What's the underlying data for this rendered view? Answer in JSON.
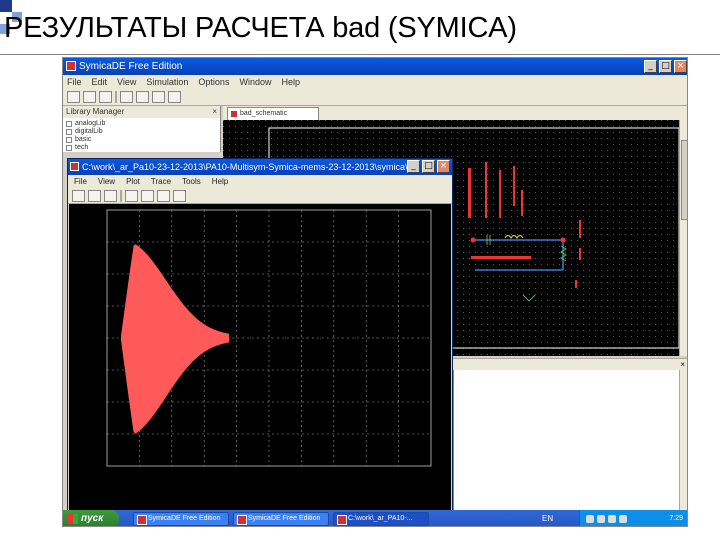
{
  "slide": {
    "title": "РЕЗУЛЬТАТЫ РАСЧЕТА bad (SYMICA)"
  },
  "ide": {
    "title": "SymicaDE Free Edition",
    "menu": [
      "File",
      "Edit",
      "View",
      "Simulation",
      "Options",
      "Window",
      "Help"
    ],
    "left_panel_title": "Library Manager",
    "tree": [
      "analogLib",
      "digitalLib",
      "basic",
      "tech"
    ],
    "schematic_tab": "bad_schematic"
  },
  "plot": {
    "title": "C:\\work\\_ar_Pa10-23-12-2013\\PA10-Multisym-Symica-mems-23-12-2013\\symica\\...",
    "menu": [
      "File",
      "View",
      "Plot",
      "Trace",
      "Tools",
      "Help"
    ],
    "colors": {
      "background": "#000000",
      "grid": "#a0a0a0",
      "trace": "#ff5a5a",
      "labels": "#c8c8c8"
    }
  },
  "chart_data": {
    "type": "area",
    "title": "",
    "xlabel": "",
    "ylabel": "",
    "grid": true,
    "colors": {
      "trace": "#ff5a5a"
    }
  },
  "taskbar": {
    "start": "пуск",
    "tasks": [
      "SymicaDE Free Edition",
      "SymicaDE Free Edition",
      "C:\\work\\_ar_PA10-..."
    ],
    "lang": "EN",
    "clock": "7:29"
  }
}
